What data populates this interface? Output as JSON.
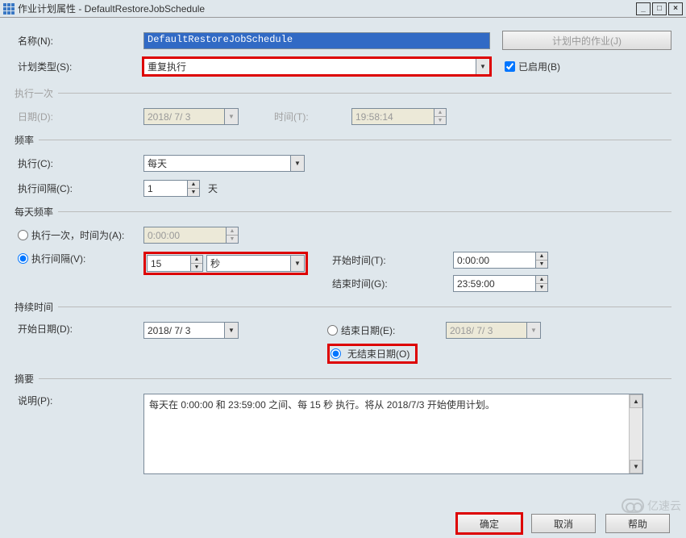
{
  "window": {
    "title": "作业计划属性 - DefaultRestoreJobSchedule"
  },
  "buttons": {
    "minimize": "_",
    "maximize": "□",
    "close": "×",
    "jobs_in_schedule": "计划中的作业(J)",
    "ok": "确定",
    "cancel": "取消",
    "help": "帮助"
  },
  "fields": {
    "name_label": "名称(N):",
    "name_value": "DefaultRestoreJobSchedule",
    "schedule_type_label": "计划类型(S):",
    "schedule_type_value": "重复执行",
    "enabled_label": " 已启用(B)"
  },
  "sections": {
    "one_time": "执行一次",
    "frequency": "频率",
    "daily_frequency": "每天频率",
    "duration": "持续时间",
    "summary": "摘要"
  },
  "one_time": {
    "date_label": "日期(D):",
    "date_value": "2018/ 7/ 3",
    "time_label": "时间(T):",
    "time_value": "19:58:14"
  },
  "frequency": {
    "occurs_label": "执行(C):",
    "occurs_value": "每天",
    "recurs_label": "执行间隔(C):",
    "recurs_value": "1",
    "recurs_unit": "天"
  },
  "daily_frequency": {
    "occurs_once_label": " 执行一次，时间为(A):",
    "occurs_once_value": "0:00:00",
    "occurs_every_label": " 执行间隔(V):",
    "occurs_every_value": "15",
    "occurs_every_unit": "秒",
    "start_time_label": "开始时间(T):",
    "start_time_value": "0:00:00",
    "end_time_label": "结束时间(G):",
    "end_time_value": "23:59:00"
  },
  "duration": {
    "start_date_label": "开始日期(D):",
    "start_date_value": "2018/ 7/ 3",
    "end_date_label": " 结束日期(E):",
    "end_date_value": "2018/ 7/ 3",
    "no_end_date_label": " 无结束日期(O)"
  },
  "summary": {
    "description_label": "说明(P):",
    "description_value": "每天在 0:00:00 和 23:59:00 之间、每 15 秒 执行。将从 2018/7/3 开始使用计划。"
  },
  "watermark": "亿速云"
}
